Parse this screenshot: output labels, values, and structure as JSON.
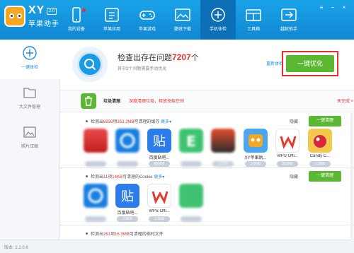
{
  "brand": {
    "name_xy": "XY",
    "version_badge": "2.0",
    "name": "苹果助手"
  },
  "nav": [
    {
      "label": "我的设备"
    },
    {
      "label": "苹果应用"
    },
    {
      "label": "苹果游戏"
    },
    {
      "label": "壁纸下载"
    },
    {
      "label": "手机体检"
    },
    {
      "label": "工具箱"
    },
    {
      "label": "越狱助手"
    }
  ],
  "sidebar": [
    {
      "label": "一键体检"
    },
    {
      "label": "大文件管理"
    },
    {
      "label": "照片压缩"
    }
  ],
  "summary": {
    "title_prefix": "检查出存在问题",
    "count": "7207",
    "title_suffix": "个",
    "sub_prefix": "其中",
    "sub_count": "2",
    "sub_suffix": "个问题需要手动优化",
    "rescan": "重新体检",
    "optimize_button": "一键优化"
  },
  "category": {
    "title": "垃圾清理",
    "desc": "深度清理垃圾，释放充裕空间",
    "state": "未完成"
  },
  "sections": [
    {
      "prefix": "检测出",
      "count": "6930",
      "mid": "项",
      "size": "352.2MB",
      "suffix": "可清理的缓存",
      "more": "更多",
      "collapse": "隐藏",
      "button": "一键清理",
      "apps": [
        {
          "name": "",
          "size": ""
        },
        {
          "name": "",
          "size": ""
        },
        {
          "name": "百度贴吧...",
          "size": "966KB"
        },
        {
          "name": "",
          "size": ""
        },
        {
          "name": "",
          "size": "4.2MB"
        },
        {
          "name": "XY苹果助...",
          "size": "3.9MB"
        },
        {
          "name": "WPS Offi...",
          "size": "261KB"
        },
        {
          "name": "Candy C...",
          "size": "1.3MB"
        }
      ]
    },
    {
      "prefix": "检测出",
      "count": "11",
      "mid": "项",
      "size": "14KB",
      "suffix": "可清理的Cookie",
      "more": "更多",
      "collapse": "隐藏",
      "button": "一键清理",
      "apps": [
        {
          "name": "",
          "size": ""
        },
        {
          "name": "百度贴吧...",
          "size": "2.5KB"
        },
        {
          "name": "WPS Offi...",
          "size": "2.5KB"
        },
        {
          "name": "",
          "size": ""
        }
      ]
    },
    {
      "prefix": "检测出",
      "count": "261",
      "mid": "项",
      "size": "16.3MB",
      "suffix": "可清理的临时文件"
    }
  ],
  "footer": {
    "version": "版本: 2.2.0.6"
  },
  "colors": {
    "header": "#1187d3",
    "accent_green": "#5cb833",
    "alert_red": "#e8312d",
    "link_blue": "#1a8be0"
  }
}
